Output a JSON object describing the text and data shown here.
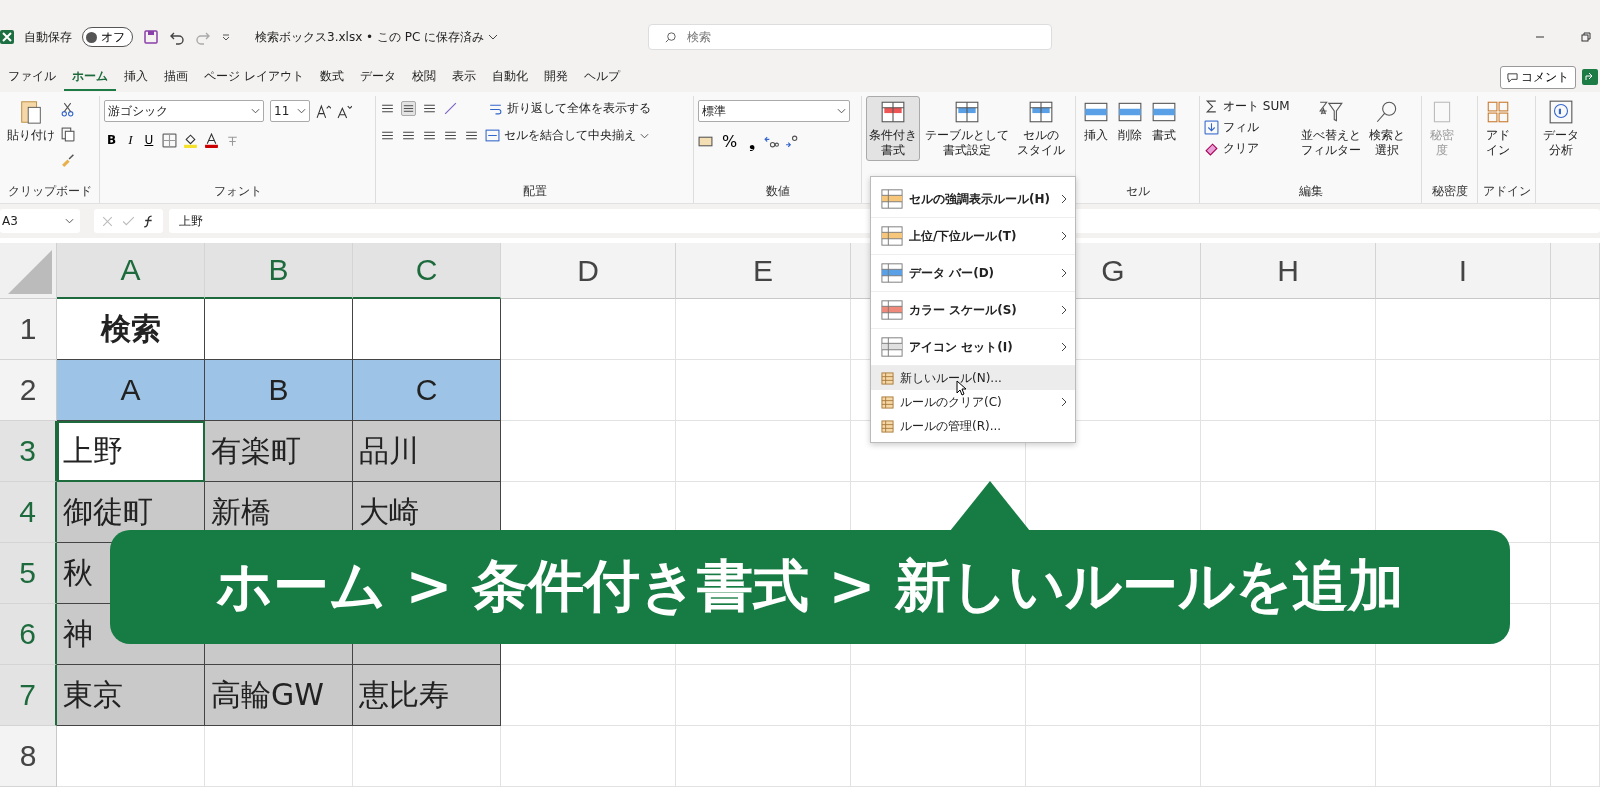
{
  "title_bar": {
    "autosave_label": "自動保存",
    "autosave_toggle": "オフ",
    "autosave_on": false,
    "filename": "検索ボックス3.xlsx • この PC に保存済み",
    "search": {
      "placeholder": "検索"
    }
  },
  "menu_tabs": [
    {
      "label": "ファイル",
      "selected": false
    },
    {
      "label": "ホーム",
      "selected": true
    },
    {
      "label": "挿入",
      "selected": false
    },
    {
      "label": "描画",
      "selected": false
    },
    {
      "label": "ページ レイアウト",
      "selected": false
    },
    {
      "label": "数式",
      "selected": false
    },
    {
      "label": "データ",
      "selected": false
    },
    {
      "label": "校閲",
      "selected": false
    },
    {
      "label": "表示",
      "selected": false
    },
    {
      "label": "自動化",
      "selected": false
    },
    {
      "label": "開発",
      "selected": false
    },
    {
      "label": "ヘルプ",
      "selected": false
    }
  ],
  "comment_button": "コメント",
  "ribbon": {
    "clipboard": {
      "paste": "貼り付け",
      "label": "クリップボード"
    },
    "font": {
      "name": "游ゴシック",
      "size": "11",
      "bold": "B",
      "italic": "I",
      "underline": "U",
      "label": "フォント"
    },
    "alignment": {
      "wrap": "折り返して全体を表示する",
      "merge": "セルを結合して中央揃え",
      "label": "配置"
    },
    "number": {
      "format": "標準",
      "percent": "%",
      "comma": "❟",
      "label": "数値"
    },
    "styles": [
      {
        "lines": [
          "条件付き",
          "書式"
        ],
        "selected": true
      },
      {
        "lines": [
          "テーブルとして",
          "書式設定"
        ],
        "selected": false
      },
      {
        "lines": [
          "セルの",
          "スタイル"
        ],
        "selected": false
      }
    ],
    "cells": {
      "buttons": [
        "挿入",
        "削除",
        "書式"
      ],
      "label": "セル"
    },
    "editing": {
      "autosum": "オート SUM",
      "fill": "フィル",
      "clear": "クリア",
      "sort": [
        "並べ替えと",
        "フィルター"
      ],
      "find": [
        "検索と",
        "選択"
      ],
      "label": "編集"
    },
    "sensitivity": {
      "lines": [
        "秘密",
        "度"
      ],
      "disabled": true,
      "label": "秘密度"
    },
    "addins": {
      "lines": [
        "アド",
        "イン"
      ],
      "label": "アドイン"
    },
    "analysis": {
      "lines": [
        "データ",
        "分析"
      ]
    }
  },
  "formula_bar": {
    "name_box": "A3",
    "value": "上野"
  },
  "sheet": {
    "columns": [
      {
        "label": "A"
      },
      {
        "label": "B"
      },
      {
        "label": "C"
      },
      {
        "label": "D"
      },
      {
        "label": "E"
      },
      {},
      {
        "label": "G"
      },
      {
        "label": "H"
      },
      {
        "label": "I"
      }
    ],
    "rows": [
      {
        "num": "1",
        "cells": [
          {
            "kind": "title",
            "text": "検索"
          },
          {
            "kind": "title"
          },
          {
            "kind": "title"
          }
        ]
      },
      {
        "num": "2",
        "cells": [
          {
            "kind": "header",
            "text": "A"
          },
          {
            "kind": "header",
            "text": "B"
          },
          {
            "kind": "header",
            "text": "C"
          }
        ]
      },
      {
        "num": "3",
        "cells": [
          {
            "kind": "data",
            "text": "上野",
            "selected": true,
            "active": true
          },
          {
            "kind": "data",
            "text": "有楽町",
            "selected": true,
            "active": false
          },
          {
            "kind": "data",
            "text": "品川",
            "selected": true,
            "active": false
          }
        ]
      },
      {
        "num": "4",
        "cells": [
          {
            "kind": "data",
            "text": "御徒町",
            "selected": true,
            "active": false
          },
          {
            "kind": "data",
            "text": "新橋",
            "selected": true,
            "active": false
          },
          {
            "kind": "data",
            "text": "大崎",
            "selected": true,
            "active": false
          }
        ]
      },
      {
        "num": "5",
        "cells": [
          {
            "kind": "data",
            "text": "秋",
            "selected": true,
            "active": false
          },
          {
            "kind": "data"
          },
          {
            "kind": "data"
          }
        ]
      },
      {
        "num": "6",
        "cells": [
          {
            "kind": "data",
            "text": "神",
            "selected": true,
            "active": false
          },
          {
            "kind": "data",
            "selected": true,
            "active": false
          },
          {
            "kind": "data",
            "selected": true,
            "active": false
          }
        ]
      },
      {
        "num": "7",
        "cells": [
          {
            "kind": "data",
            "text": "東京",
            "selected": true,
            "active": false
          },
          {
            "kind": "data",
            "text": "高輪GW",
            "selected": true,
            "active": false
          },
          {
            "kind": "data",
            "text": "恵比寿",
            "selected": true,
            "active": false
          }
        ]
      },
      {
        "num": "8",
        "cells": []
      }
    ]
  },
  "dropdown_menu": [
    {
      "kind": "large",
      "label": "セルの強調表示ルール(H)",
      "submenu": true,
      "hover": false
    },
    {
      "kind": "large",
      "label": "上位/下位ルール(T)",
      "submenu": true,
      "hover": false
    },
    {
      "kind": "large",
      "label": "データ バー(D)",
      "submenu": true,
      "hover": false
    },
    {
      "kind": "large",
      "label": "カラー スケール(S)",
      "submenu": true,
      "hover": false
    },
    {
      "kind": "large",
      "label": "アイコン セット(I)",
      "submenu": true,
      "hover": false
    },
    {
      "kind": "small",
      "label": "新しいルール(N)...",
      "submenu": false,
      "hover": true
    },
    {
      "kind": "small",
      "label": "ルールのクリア(C)",
      "submenu": true,
      "hover": false
    },
    {
      "kind": "small",
      "label": "ルールの管理(R)...",
      "submenu": false,
      "hover": false
    }
  ],
  "caption": "ホーム > 条件付き書式 > 新しいルールを追加"
}
